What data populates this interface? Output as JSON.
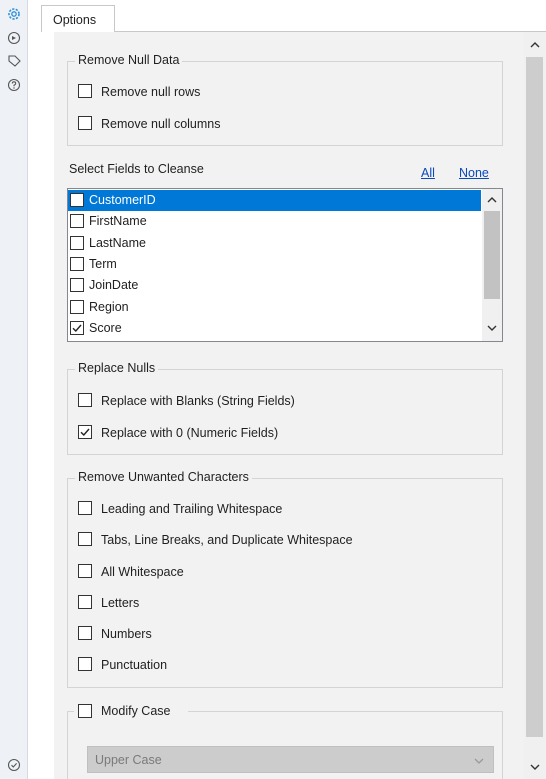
{
  "rail": {
    "icons": [
      "gear-icon",
      "target-icon",
      "tag-icon",
      "help-icon",
      "check-circle-icon"
    ]
  },
  "tab": {
    "label": "Options"
  },
  "remove_null": {
    "title": "Remove Null Data",
    "options": [
      {
        "label": "Remove null rows",
        "checked": false
      },
      {
        "label": "Remove null columns",
        "checked": false
      }
    ]
  },
  "fields": {
    "title": "Select Fields to Cleanse",
    "all_link": "All",
    "none_link": "None",
    "items": [
      {
        "label": "CustomerID",
        "checked": false,
        "selected": true
      },
      {
        "label": "FirstName",
        "checked": false,
        "selected": false
      },
      {
        "label": "LastName",
        "checked": false,
        "selected": false
      },
      {
        "label": "Term",
        "checked": false,
        "selected": false
      },
      {
        "label": "JoinDate",
        "checked": false,
        "selected": false
      },
      {
        "label": "Region",
        "checked": false,
        "selected": false
      },
      {
        "label": "Score",
        "checked": true,
        "selected": false
      }
    ]
  },
  "replace_nulls": {
    "title": "Replace Nulls",
    "options": [
      {
        "label": "Replace with Blanks (String Fields)",
        "checked": false
      },
      {
        "label": "Replace with 0 (Numeric Fields)",
        "checked": true
      }
    ]
  },
  "remove_chars": {
    "title": "Remove Unwanted Characters",
    "options": [
      {
        "label": "Leading and Trailing Whitespace",
        "checked": false
      },
      {
        "label": "Tabs, Line Breaks, and Duplicate Whitespace",
        "checked": false
      },
      {
        "label": "All Whitespace",
        "checked": false
      },
      {
        "label": "Letters",
        "checked": false
      },
      {
        "label": "Numbers",
        "checked": false
      },
      {
        "label": "Punctuation",
        "checked": false
      }
    ]
  },
  "modify_case": {
    "label": "Modify Case",
    "checked": false,
    "selected_value": "Upper Case"
  },
  "colors": {
    "accent": "#0078d7",
    "link": "#0a49b8",
    "panel_bg": "#f2f2f2"
  }
}
